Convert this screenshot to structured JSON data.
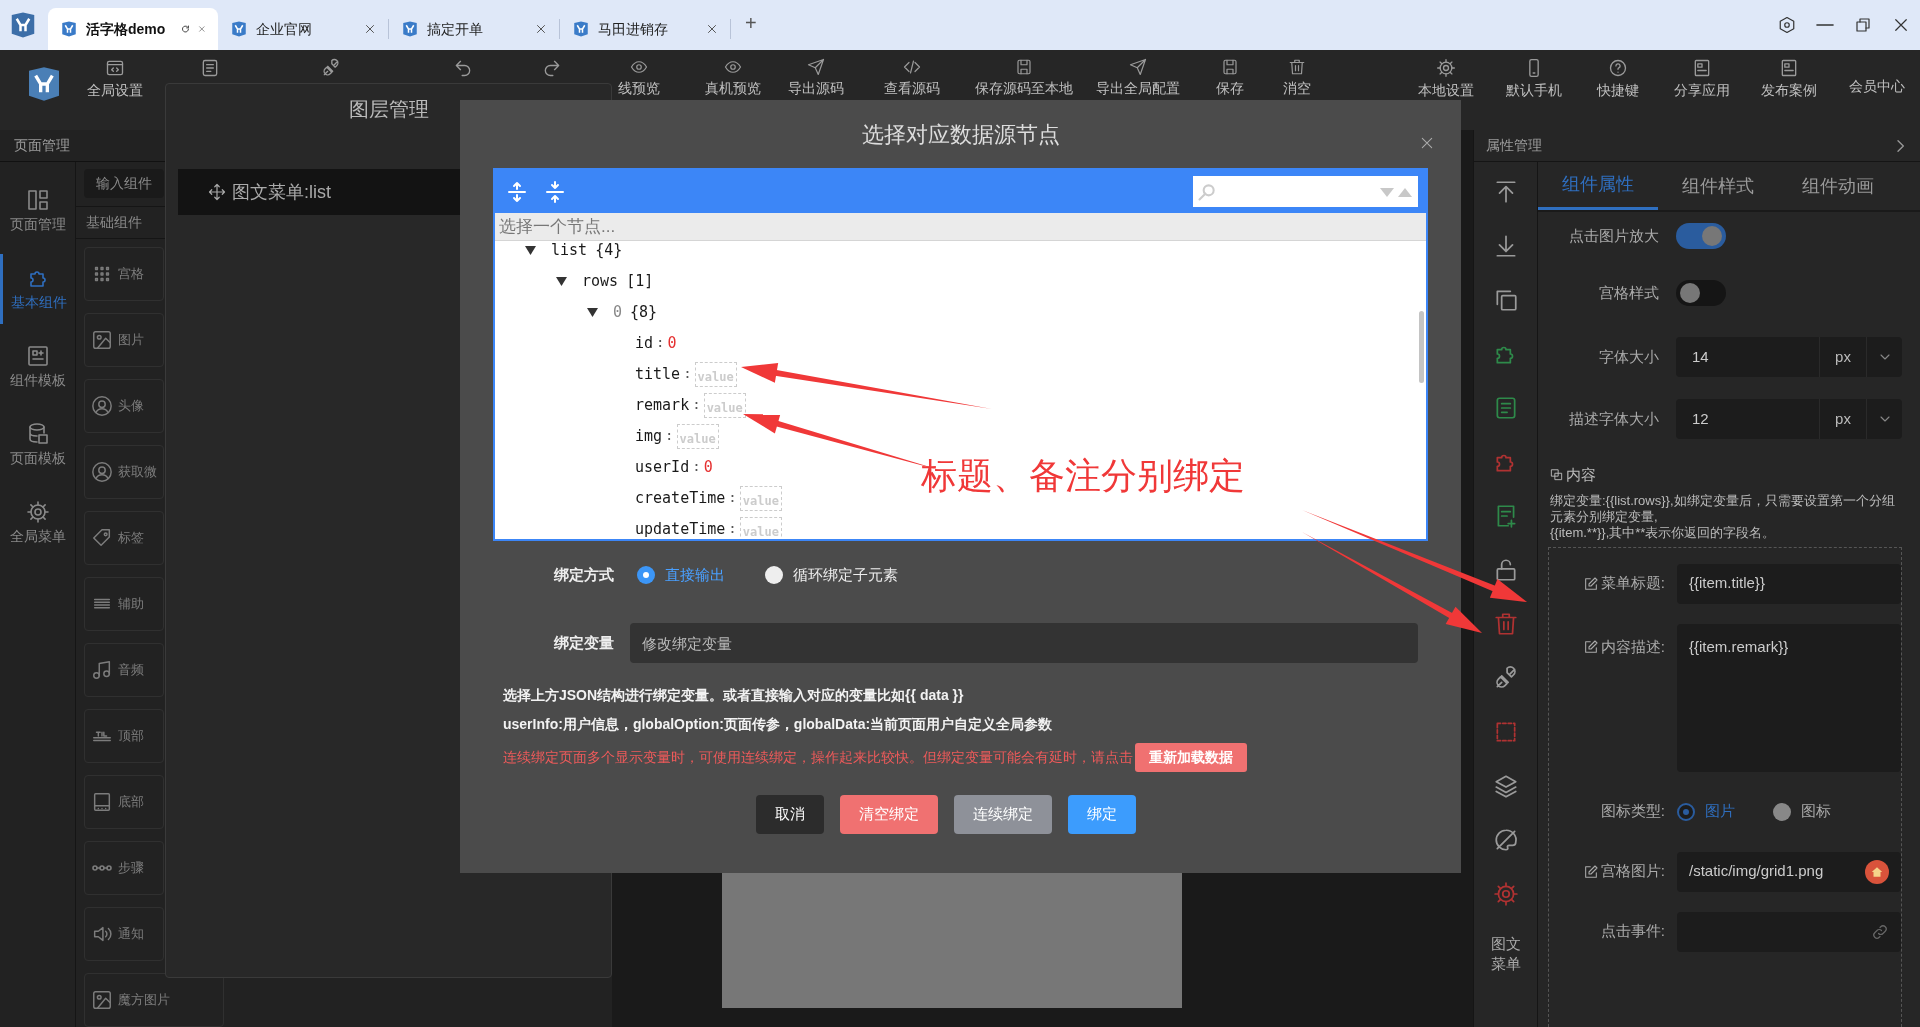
{
  "browser_tabs": [
    {
      "title": "活字格demo",
      "selected": true
    },
    {
      "title": "企业官网",
      "selected": false
    },
    {
      "title": "搞定开单",
      "selected": false
    },
    {
      "title": "马田进销存",
      "selected": false
    }
  ],
  "new_tab": "+",
  "toolbar": {
    "left": [
      {
        "kind": "labeled",
        "label": "全局设置"
      },
      {
        "kind": "icon"
      },
      {
        "kind": "icon"
      },
      {
        "kind": "icon"
      },
      {
        "kind": "icon"
      }
    ],
    "middle": [
      "线预览",
      "真机预览",
      "导出源码",
      "查看源码",
      "保存源码至本地",
      "导出全局配置",
      "保存",
      "消空"
    ],
    "right": [
      "本地设置",
      "默认手机",
      "快捷键",
      "分享应用",
      "发布案例"
    ],
    "account": "会员中心"
  },
  "left_panel": {
    "title": "页面管理",
    "nav": [
      {
        "label": "页面管理",
        "selected": false
      },
      {
        "label": "基本组件",
        "selected": true
      },
      {
        "label": "组件模板",
        "selected": false
      },
      {
        "label": "页面模板",
        "selected": false
      },
      {
        "label": "全局菜单",
        "selected": false
      }
    ],
    "search": {
      "placeholder": "输入组件"
    },
    "section": "基础组件",
    "components": [
      "宫格",
      "图片",
      "头像",
      "获取微",
      "标签",
      "辅助",
      "音频",
      "顶部",
      "底部",
      "步骤",
      "通知",
      "魔方图片"
    ]
  },
  "layer_dialog": {
    "title": "图层管理",
    "layers": [
      "图文菜单:list"
    ]
  },
  "modal": {
    "title": "选择对应数据源节点",
    "json_editor": {
      "node_path": "选择一个节点...",
      "separator": ":",
      "tree": [
        {
          "key": "list",
          "meta": "{4}",
          "expanded": true,
          "children": [
            {
              "key": "rows",
              "meta": "[1]",
              "expanded": true,
              "children": [
                {
                  "key": "0",
                  "meta": "{8}",
                  "expanded": true,
                  "children": [
                    {
                      "key": "id",
                      "kind": "number",
                      "value": "0"
                    },
                    {
                      "key": "title",
                      "kind": "empty",
                      "placeholder": "value"
                    },
                    {
                      "key": "remark",
                      "kind": "empty",
                      "placeholder": "value"
                    },
                    {
                      "key": "img",
                      "kind": "empty",
                      "placeholder": "value"
                    },
                    {
                      "key": "userId",
                      "kind": "number",
                      "value": "0"
                    },
                    {
                      "key": "createTime",
                      "kind": "empty",
                      "placeholder": "value"
                    },
                    {
                      "key": "updateTime",
                      "kind": "empty",
                      "placeholder": "value"
                    }
                  ]
                }
              ]
            }
          ]
        }
      ]
    },
    "binding_mode": {
      "label": "绑定方式",
      "options": [
        {
          "label": "直接输出",
          "selected": true
        },
        {
          "label": "循环绑定子元素",
          "selected": false
        }
      ]
    },
    "binding_variable": {
      "label": "绑定变量",
      "placeholder": "修改绑定变量"
    },
    "notes": [
      {
        "kind": "plain",
        "text": "选择上方JSON结构进行绑定变量。或者直接输入对应的变量比如{{ data }}"
      },
      {
        "kind": "plain",
        "text": "userInfo:用户信息，globalOption:页面传参，globalData:当前页面用户自定义全局参数"
      },
      {
        "kind": "warning",
        "text": "连续绑定页面多个显示变量时，可使用连续绑定，操作起来比较快。但绑定变量可能会有延时，请点击",
        "button": "重新加载数据"
      }
    ],
    "buttons": [
      {
        "label": "取消",
        "kind": "dark"
      },
      {
        "label": "清空绑定",
        "kind": "danger"
      },
      {
        "label": "连续绑定",
        "kind": "muted"
      },
      {
        "label": "绑定",
        "kind": "primary"
      }
    ]
  },
  "annotation": "标题、备注分别绑定",
  "right_panel": {
    "title": "属性管理",
    "tools_label": "图文菜单",
    "tabs": [
      {
        "label": "组件属性",
        "selected": true
      },
      {
        "label": "组件样式",
        "selected": false
      },
      {
        "label": "组件动画",
        "selected": false
      }
    ],
    "properties": [
      {
        "kind": "toggle",
        "label": "点击图片放大",
        "on": true
      },
      {
        "kind": "toggle",
        "label": "宫格样式",
        "on": false
      },
      {
        "kind": "size",
        "label": "字体大小",
        "value": "14",
        "unit": "px"
      },
      {
        "kind": "size",
        "label": "描述字体大小",
        "value": "12",
        "unit": "px"
      }
    ],
    "content": {
      "title": "内容",
      "hint": [
        "绑定变量:{{list.rows}},如绑定变量后，只需要设置第一个分组元素分别绑定变量,",
        "{{item.**}},其中**表示你返回的字段名。"
      ],
      "fields": [
        {
          "kind": "text",
          "label": "菜单标题:",
          "editable": true,
          "value": "{{item.title}}"
        },
        {
          "kind": "textarea",
          "label": "内容描述:",
          "editable": true,
          "value": "{{item.remark}}"
        },
        {
          "kind": "radio",
          "label": "图标类型:",
          "editable": false,
          "options": [
            {
              "label": "图片",
              "selected": true
            },
            {
              "label": "图标",
              "selected": false
            }
          ]
        },
        {
          "kind": "image",
          "label": "宫格图片:",
          "editable": true,
          "value": "/static/img/grid1.png"
        },
        {
          "kind": "link",
          "label": "点击事件:",
          "editable": false
        }
      ]
    }
  }
}
